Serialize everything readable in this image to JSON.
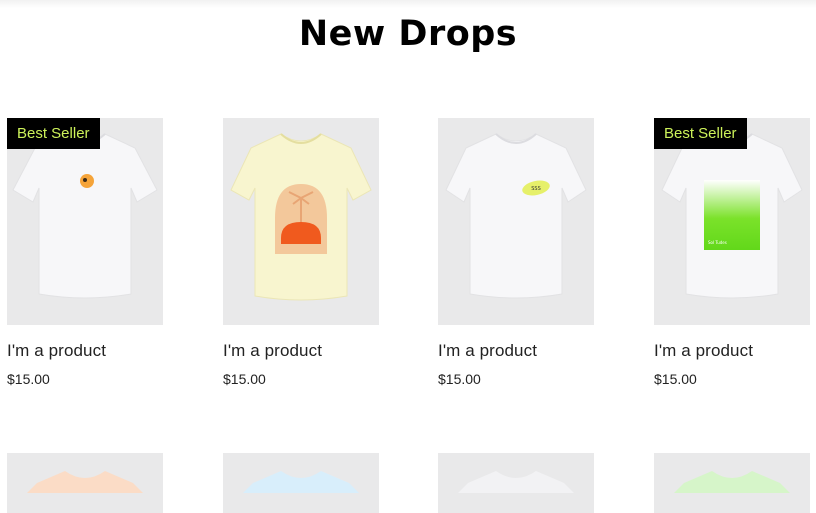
{
  "section": {
    "title": "New Drops"
  },
  "products": [
    {
      "name": "I'm a product",
      "price": "$15.00",
      "badge": "Best Seller",
      "shirt_color": "#f7f7f9",
      "print": "peach-emoji"
    },
    {
      "name": "I'm a product",
      "price": "$15.00",
      "badge": "",
      "shirt_color": "#f8f5cf",
      "print": "palm-sunset"
    },
    {
      "name": "I'm a product",
      "price": "$15.00",
      "badge": "",
      "shirt_color": "#f7f7f9",
      "print": "yellow-oval",
      "print_text": "SSS"
    },
    {
      "name": "I'm a product",
      "price": "$15.00",
      "badge": "Best Seller",
      "shirt_color": "#f7f7f9",
      "print": "green-gradient",
      "print_text": "Sol Tudes"
    }
  ],
  "next_row_shirt_colors": [
    "#fbdcc6",
    "#d8eefb",
    "#f2f2f4",
    "#d6f5c9"
  ],
  "colors": {
    "badge_bg": "#000000",
    "badge_text": "#cdf25a",
    "image_bg": "#e9e9ea"
  }
}
